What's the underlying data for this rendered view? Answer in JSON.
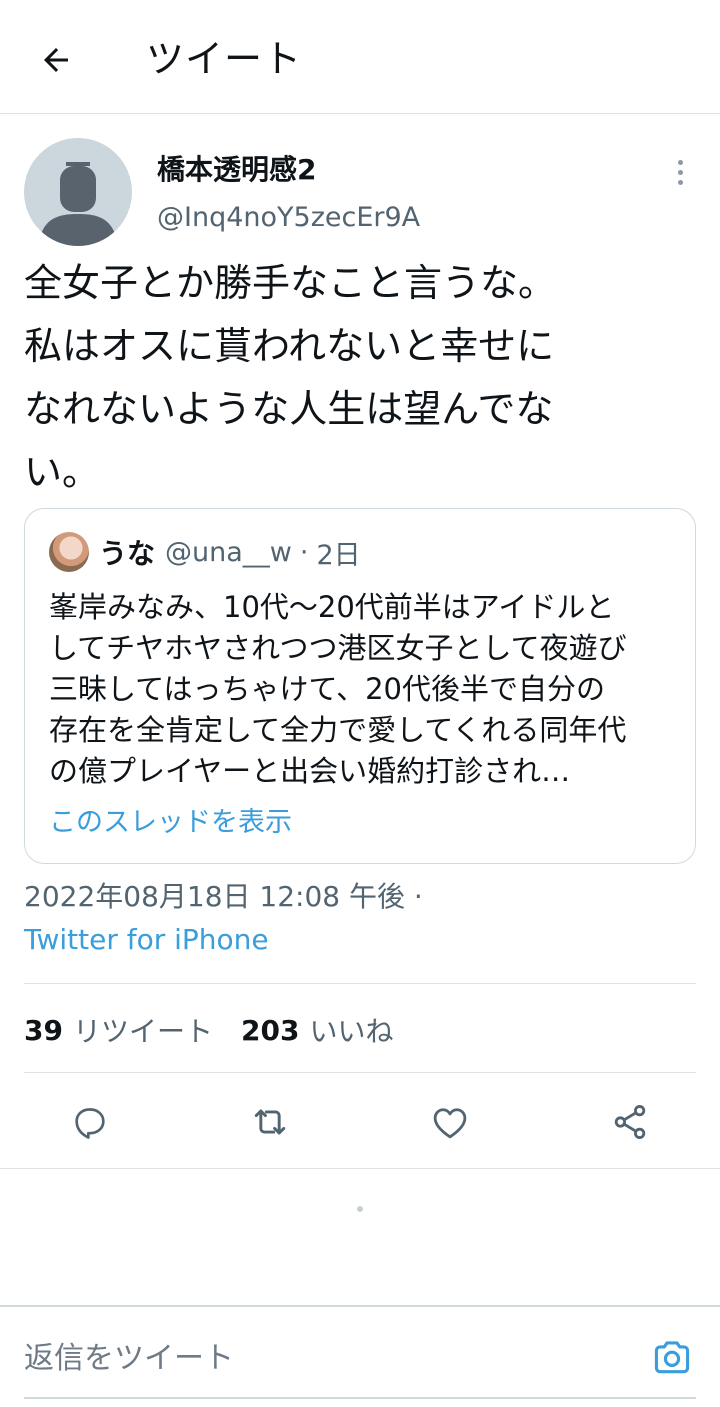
{
  "header": {
    "title": "ツイート",
    "back_icon": "arrow-left-icon"
  },
  "tweet": {
    "author": {
      "display_name": "橋本透明感2",
      "handle": "@Inq4noY5zecEr9A",
      "avatar": "default-avatar"
    },
    "text": "全女子とか勝手なこと言うな。\n私はオスに貰われないと幸せに\nなれないような人生は望んでな\nい。",
    "quote": {
      "name": "うな",
      "handle": "@una__w",
      "separator": "·",
      "time": "2日",
      "text": "峯岸みなみ、10代〜20代前半はアイドルと\nしてチヤホヤされつつ港区女子として夜遊び\n三昧してはっちゃけて、20代後半で自分の\n存在を全肯定して全力で愛してくれる同年代\nの億プレイヤーと出会い婚約打診され…",
      "show_thread": "このスレッドを表示"
    },
    "timestamp": "2022年08月18日 12:08 午後 ·",
    "source": "Twitter for iPhone",
    "stats": {
      "retweets_count": "39",
      "retweets_label": "リツイート",
      "likes_count": "203",
      "likes_label": "いいね"
    }
  },
  "actions": [
    "reply-icon",
    "retweet-icon",
    "like-icon",
    "share-icon"
  ],
  "reply_bar": {
    "placeholder": "返信をツイート",
    "camera_icon": "camera-icon"
  },
  "colors": {
    "link": "#3a9ddc",
    "secondary_text": "#536471",
    "border": "#dfe3e6"
  }
}
